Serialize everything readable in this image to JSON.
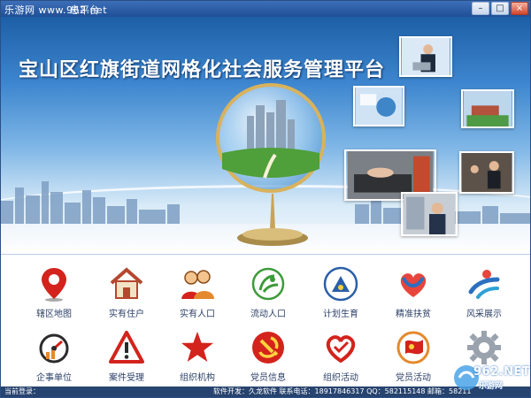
{
  "window": {
    "title": "乐游网 www.962.net",
    "title_suffix": "息平台",
    "buttons": {
      "minimize": "–",
      "maximize": "□",
      "close": "×"
    }
  },
  "banner": {
    "title": "宝山区红旗街道网格化社会服务管理平台"
  },
  "modules": [
    {
      "label": "辖区地图",
      "icon": "map-pin-icon"
    },
    {
      "label": "实有住户",
      "icon": "house-icon"
    },
    {
      "label": "实有人口",
      "icon": "people-icon"
    },
    {
      "label": "流动人口",
      "icon": "floating-population-icon"
    },
    {
      "label": "计划生育",
      "icon": "family-planning-icon"
    },
    {
      "label": "精准扶贫",
      "icon": "poverty-heart-icon"
    },
    {
      "label": "风采展示",
      "icon": "showcase-icon"
    },
    {
      "label": "企事单位",
      "icon": "enterprise-gauge-icon"
    },
    {
      "label": "案件受理",
      "icon": "warning-icon"
    },
    {
      "label": "组织机构",
      "icon": "star-icon"
    },
    {
      "label": "党员信息",
      "icon": "party-emblem-icon"
    },
    {
      "label": "组织活动",
      "icon": "heart-icon"
    },
    {
      "label": "党员活动",
      "icon": "party-flag-icon"
    },
    {
      "label": "",
      "icon": "gear-icon"
    }
  ],
  "statusbar": {
    "login": "当前登录：",
    "info": "软件开发：久龙软件   联系电话：18917846317   QQ：582115148  邮箱：58211"
  },
  "watermark": {
    "brand": "962.NET",
    "sub": "乐游网"
  },
  "colors": {
    "titlebar": "#1f4f97",
    "party_red": "#d3231c",
    "icon_blue": "#2b6fc0",
    "label": "#2b3f66",
    "statusbar": "#27436f"
  }
}
